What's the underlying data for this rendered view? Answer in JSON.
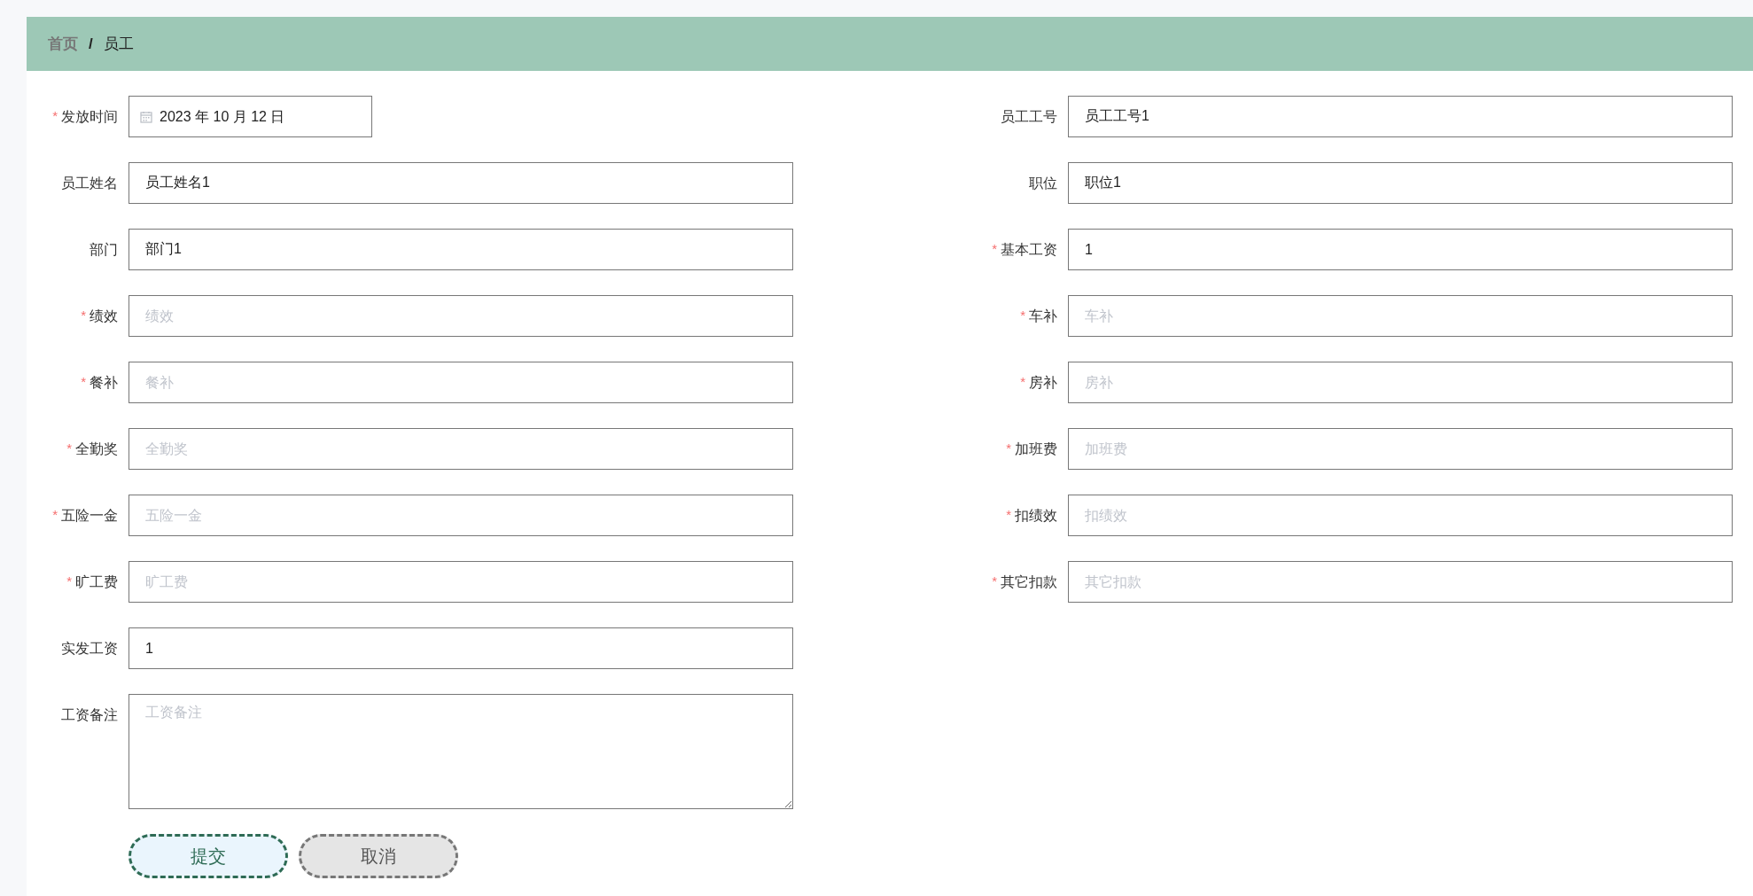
{
  "breadcrumb": [
    {
      "label": "首页",
      "current": false
    },
    {
      "label": "员工",
      "current": true
    }
  ],
  "breadcrumb_separator": "/",
  "rows": [
    {
      "left": {
        "kind": "date",
        "label": "发放时间",
        "required": true,
        "value": "2023 年 10 月 12 日"
      },
      "right": {
        "kind": "text",
        "label": "员工工号",
        "required": false,
        "value": "员工工号1"
      }
    },
    {
      "left": {
        "kind": "text",
        "label": "员工姓名",
        "required": false,
        "value": "员工姓名1"
      },
      "right": {
        "kind": "text",
        "label": "职位",
        "required": false,
        "value": "职位1"
      }
    },
    {
      "left": {
        "kind": "text",
        "label": "部门",
        "required": false,
        "value": "部门1"
      },
      "right": {
        "kind": "text",
        "label": "基本工资",
        "required": true,
        "value": "1"
      }
    },
    {
      "left": {
        "kind": "text",
        "label": "绩效",
        "required": true,
        "placeholder": "绩效"
      },
      "right": {
        "kind": "text",
        "label": "车补",
        "required": true,
        "placeholder": "车补"
      }
    },
    {
      "left": {
        "kind": "text",
        "label": "餐补",
        "required": true,
        "placeholder": "餐补"
      },
      "right": {
        "kind": "text",
        "label": "房补",
        "required": true,
        "placeholder": "房补"
      }
    },
    {
      "left": {
        "kind": "text",
        "label": "全勤奖",
        "required": true,
        "placeholder": "全勤奖"
      },
      "right": {
        "kind": "text",
        "label": "加班费",
        "required": true,
        "placeholder": "加班费"
      }
    },
    {
      "left": {
        "kind": "text",
        "label": "五险一金",
        "required": true,
        "placeholder": "五险一金"
      },
      "right": {
        "kind": "text",
        "label": "扣绩效",
        "required": true,
        "placeholder": "扣绩效"
      }
    },
    {
      "left": {
        "kind": "text",
        "label": "旷工费",
        "required": true,
        "placeholder": "旷工费"
      },
      "right": {
        "kind": "text",
        "label": "其它扣款",
        "required": true,
        "placeholder": "其它扣款"
      }
    },
    {
      "left": {
        "kind": "text",
        "label": "实发工资",
        "required": false,
        "value": "1"
      }
    },
    {
      "left": {
        "kind": "textarea",
        "label": "工资备注",
        "required": false,
        "placeholder": "工资备注"
      }
    }
  ],
  "required_mark": "*",
  "buttons": [
    {
      "label": "提交",
      "kind": "primary"
    },
    {
      "label": "取消",
      "kind": "secondary"
    }
  ]
}
